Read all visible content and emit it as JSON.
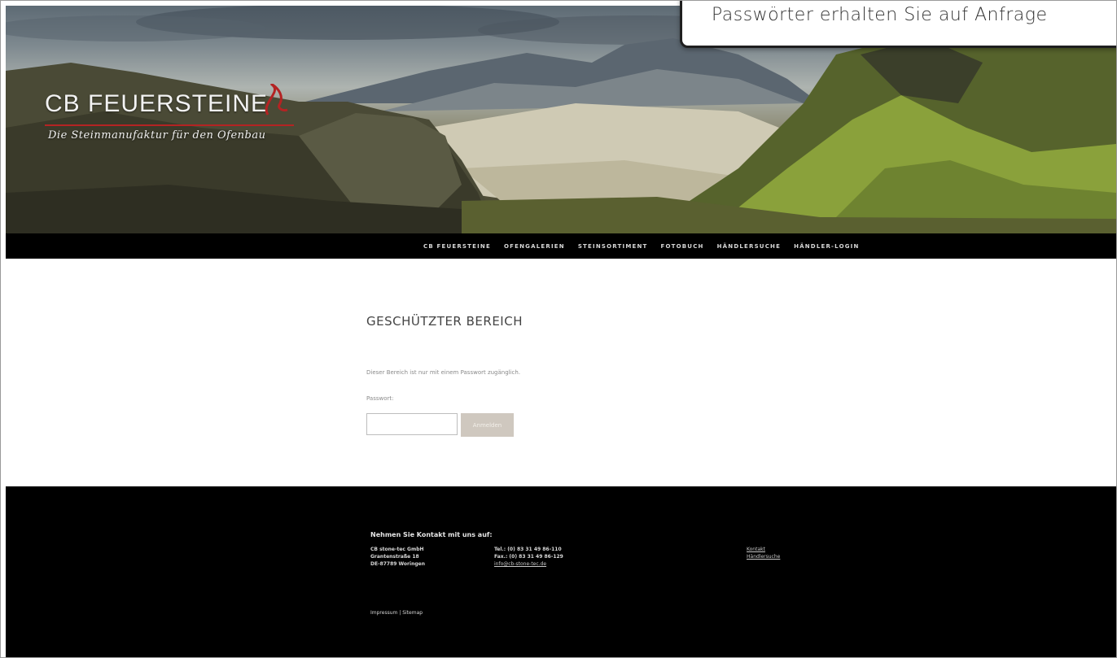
{
  "header": {
    "logo_title": "CB FEUERSTEINE",
    "logo_tagline": "Die Steinmanufaktur für den Ofenbau"
  },
  "nav": {
    "items": [
      "CB FEUERSTEINE",
      "OFENGALERIEN",
      "STEINSORTIMENT",
      "FOTOBUCH",
      "HÄNDLERSUCHE",
      "HÄNDLER-LOGIN"
    ]
  },
  "main": {
    "title": "GESCHÜTZTER BEREICH",
    "protected_text": "Dieser Bereich ist nur mit einem Passwort zugänglich.",
    "password_label": "Passwort:",
    "submit_label": "Anmelden"
  },
  "footer": {
    "heading": "Nehmen Sie Kontakt mit uns auf:",
    "address": [
      "CB stone-tec GmbH",
      "Grantenstraße 18",
      "DE-87789 Woringen"
    ],
    "phone": [
      "Tel.: (0) 83 31 49 86-110",
      "Fax.: (0) 83 31 49 86-129"
    ],
    "email": "info@cb-stone-tec.de",
    "links": [
      "Kontakt",
      "Händlersuche"
    ],
    "imprint": "Impressum",
    "separator": " | ",
    "sitemap": "Sitemap"
  },
  "callout": {
    "text": "Passwörter erhalten Sie auf Anfrage"
  },
  "colors": {
    "nav_bg": "#000000",
    "footer_bg": "#000000",
    "accent_red": "#b42323",
    "button_bg": "#cfc8bf"
  }
}
